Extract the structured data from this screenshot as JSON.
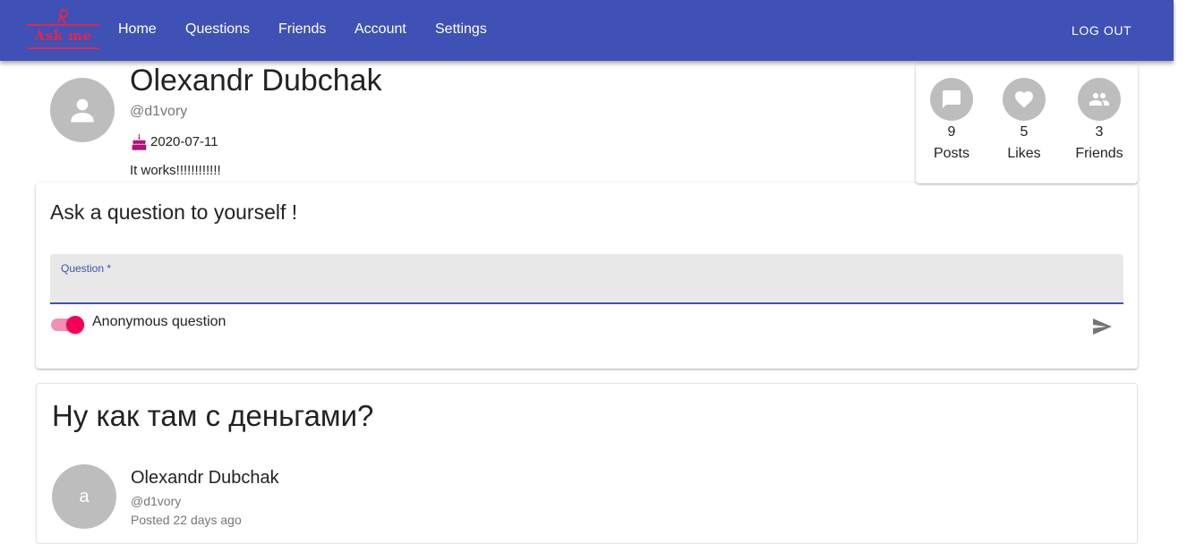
{
  "brand": {
    "logo_text": "Ask me",
    "accent": "#e2264d"
  },
  "appbar": {
    "color": "#3f51b5",
    "nav": [
      "Home",
      "Questions",
      "Friends",
      "Account",
      "Settings"
    ],
    "logout_label": "LOG OUT"
  },
  "profile": {
    "name": "Olexandr Dubchak",
    "handle": "@d1vory",
    "birthday": "2020-07-11",
    "bio": "It works!!!!!!!!!!!!"
  },
  "stats": [
    {
      "icon": "chat-icon",
      "count": "9",
      "label": "Posts"
    },
    {
      "icon": "heart-icon",
      "count": "5",
      "label": "Likes"
    },
    {
      "icon": "people-icon",
      "count": "3",
      "label": "Friends"
    }
  ],
  "ask": {
    "title": "Ask a question to yourself !",
    "field_label": "Question *",
    "field_value": "",
    "anonymous_label": "Anonymous question",
    "anonymous_on": true,
    "toggle_color": "#f50057"
  },
  "post": {
    "title": "Ну как там с деньгами?",
    "avatar_letter": "a",
    "author": "Olexandr Dubchak",
    "handle": "@d1vory",
    "posted": "Posted 22 days ago"
  }
}
